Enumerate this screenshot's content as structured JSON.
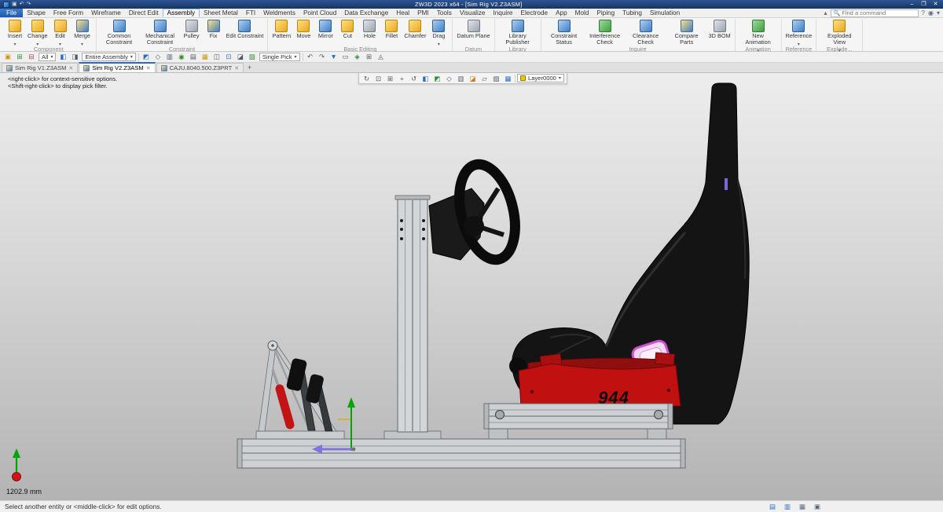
{
  "window": {
    "title": "ZW3D 2023 x64 - [Sim Rig V2.Z3ASM]"
  },
  "menu": {
    "tabs": [
      {
        "label": "File"
      },
      {
        "label": "Shape"
      },
      {
        "label": "Free Form"
      },
      {
        "label": "Wireframe"
      },
      {
        "label": "Direct Edit"
      },
      {
        "label": "Assembly"
      },
      {
        "label": "Sheet Metal"
      },
      {
        "label": "FTI"
      },
      {
        "label": "Weldments"
      },
      {
        "label": "Point Cloud"
      },
      {
        "label": "Data Exchange"
      },
      {
        "label": "Heal"
      },
      {
        "label": "PMI"
      },
      {
        "label": "Tools"
      },
      {
        "label": "Visualize"
      },
      {
        "label": "Inquire"
      },
      {
        "label": "Electrode"
      },
      {
        "label": "App"
      },
      {
        "label": "Mold"
      },
      {
        "label": "Piping"
      },
      {
        "label": "Tubing"
      },
      {
        "label": "Simulation"
      }
    ],
    "search_placeholder": "Find a command"
  },
  "ribbon": {
    "groups": [
      {
        "label": "Component",
        "buttons": [
          {
            "label": "Insert"
          },
          {
            "label": "Change"
          },
          {
            "label": "Edit"
          },
          {
            "label": "Merge"
          }
        ]
      },
      {
        "label": "Constraint",
        "buttons": [
          {
            "label": "Common Constraint"
          },
          {
            "label": "Mechanical Constraint"
          },
          {
            "label": "Pulley"
          },
          {
            "label": "Fix"
          },
          {
            "label": "Edit Constraint"
          }
        ]
      },
      {
        "label": "Basic Editing",
        "buttons": [
          {
            "label": "Pattern"
          },
          {
            "label": "Move"
          },
          {
            "label": "Mirror"
          },
          {
            "label": "Cut"
          },
          {
            "label": "Hole"
          },
          {
            "label": "Fillet"
          },
          {
            "label": "Chamfer"
          },
          {
            "label": "Drag"
          }
        ]
      },
      {
        "label": "Datum",
        "buttons": [
          {
            "label": "Datum Plane"
          }
        ]
      },
      {
        "label": "Library",
        "buttons": [
          {
            "label": "Library Publisher"
          }
        ]
      },
      {
        "label": "Inquire",
        "buttons": [
          {
            "label": "Constraint Status"
          },
          {
            "label": "Interference Check"
          },
          {
            "label": "Clearance Check"
          },
          {
            "label": "Compare Parts"
          },
          {
            "label": "3D BOM"
          }
        ]
      },
      {
        "label": "Animation",
        "buttons": [
          {
            "label": "New Animation"
          }
        ]
      },
      {
        "label": "Reference",
        "buttons": [
          {
            "label": "Reference"
          }
        ]
      },
      {
        "label": "Explode...",
        "buttons": [
          {
            "label": "Exploded View"
          }
        ]
      }
    ]
  },
  "quickbar": {
    "filter_value": "All",
    "scope_value": "Entire Assembly",
    "pick_value": "Single Pick"
  },
  "doc_tabs": {
    "tabs": [
      {
        "label": "Sim Rig V1.Z3ASM"
      },
      {
        "label": "Sim Rig V2.Z3ASM"
      },
      {
        "label": "CAJU.8040.500.Z3PRT"
      }
    ]
  },
  "viewport": {
    "hint_line1": "<right-click> for context-sensitive options.",
    "hint_line2": "<Shift-right-click> to display pick filter.",
    "layer_value": "Layer0000",
    "measurement": "1202.9 mm",
    "seat_decal": "944"
  },
  "statusbar": {
    "message": "Select another entity or <middle-click> for edit options."
  },
  "colors": {
    "accent_blue": "#2a6bc4",
    "bracket_red": "#c01010",
    "seat_black": "#141414",
    "aluminum": "#ccd0d3",
    "highlight_magenta": "#d04fd0"
  }
}
